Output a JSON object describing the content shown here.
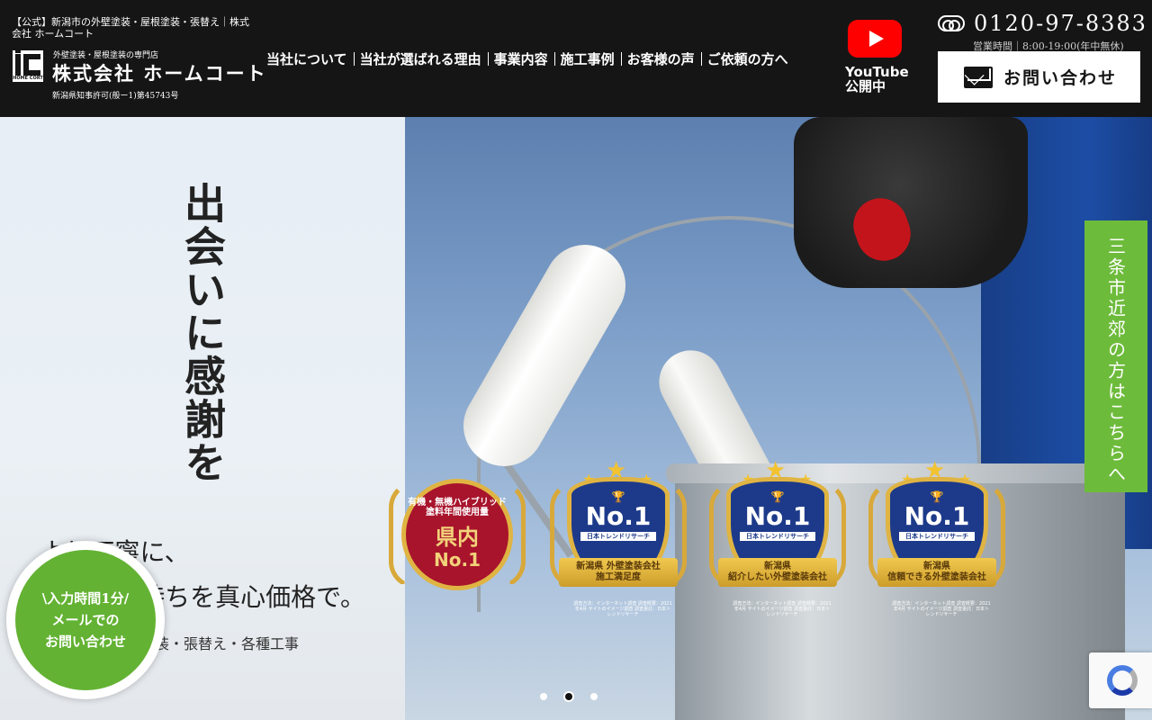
{
  "header": {
    "tagline": "【公式】新潟市の外壁塗装・屋根塗装・張替え｜株式会社 ホームコート",
    "logo_mark_text": "HOME CORT",
    "logo_sub": "外壁塗装・屋根塗装の専門店",
    "company_name": "株式会社 ホームコート",
    "license": "新潟県知事許可(般ー1)第45743号",
    "nav": [
      {
        "label": "当社について"
      },
      {
        "label": "当社が選ばれる理由"
      },
      {
        "label": "事業内容"
      },
      {
        "label": "施工事例"
      },
      {
        "label": "お客様の声"
      },
      {
        "label": "ご依頼の方へ"
      }
    ],
    "youtube": {
      "line1": "YouTube",
      "line2": "公開中"
    },
    "phone": "0120-97-8383",
    "hours": "営業時間｜8:00-19:00(年中無休)",
    "contact_label": "お問い合わせ"
  },
  "hero": {
    "catch_vertical": "出会いに感謝を",
    "catch_line1": "より丁寧に、",
    "catch_line2": "そして気持ちを真心価格で。",
    "service_line": "外壁塗装・屋根塗装・張替え・各種工事"
  },
  "badges": [
    {
      "top": "有機・無機ハイブリッド",
      "sub": "塗料年間使用量",
      "big": "県内",
      "no1": "No.1"
    },
    {
      "no1": "No.1",
      "source": "日本トレンドリサーチ",
      "ribbon1": "新潟県 外壁塗装会社",
      "ribbon2": "施工満足度",
      "note": "調査方法：インターネット調査 調査概要：2021年4月 サイトのイメージ調査 調査委託：日本トレンドリサーチ"
    },
    {
      "no1": "No.1",
      "source": "日本トレンドリサーチ",
      "ribbon1": "新潟県",
      "ribbon2": "紹介したい外壁塗装会社",
      "note": "調査方法：インターネット調査 調査概要：2021年4月 サイトのイメージ調査 調査委託：日本トレンドリサーチ"
    },
    {
      "no1": "No.1",
      "source": "日本トレンドリサーチ",
      "ribbon1": "新潟県",
      "ribbon2": "信頼できる外壁塗装会社",
      "note": "調査方法：インターネット調査 調査概要：2021年4月 サイトのイメージ調査 調査委託：日本トレンドリサーチ"
    }
  ],
  "side_tab": "三条市近郊の方はこちらへ",
  "round_cta": {
    "line1": "\\入力時間1分/",
    "line2": "メールでの",
    "line3": "お問い合わせ"
  },
  "slider": {
    "count": 3,
    "active": 2
  },
  "colors": {
    "header_bg": "#151515",
    "accent_green": "#63b233",
    "youtube_red": "#ff0000",
    "badge_navy": "#1d3a8a",
    "badge_red": "#a8142c"
  }
}
